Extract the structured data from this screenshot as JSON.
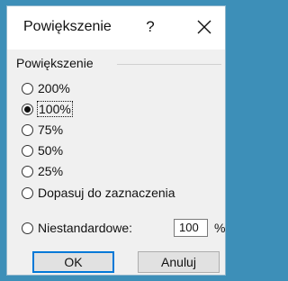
{
  "dialog": {
    "title": "Powiększenie",
    "help_label": "?",
    "close_icon": "close-icon"
  },
  "group": {
    "label": "Powiększenie",
    "options": [
      {
        "label": "200%",
        "checked": false
      },
      {
        "label": "100%",
        "checked": true
      },
      {
        "label": "75%",
        "checked": false
      },
      {
        "label": "50%",
        "checked": false
      },
      {
        "label": "25%",
        "checked": false
      },
      {
        "label": "Dopasuj do zaznaczenia",
        "checked": false
      },
      {
        "label": "Niestandardowe:",
        "checked": false
      }
    ],
    "custom_value": "100",
    "custom_unit": "%"
  },
  "buttons": {
    "ok_label": "OK",
    "cancel_label": "Anuluj"
  },
  "colors": {
    "accent": "#0078d7",
    "background": "#3d8fb8"
  }
}
